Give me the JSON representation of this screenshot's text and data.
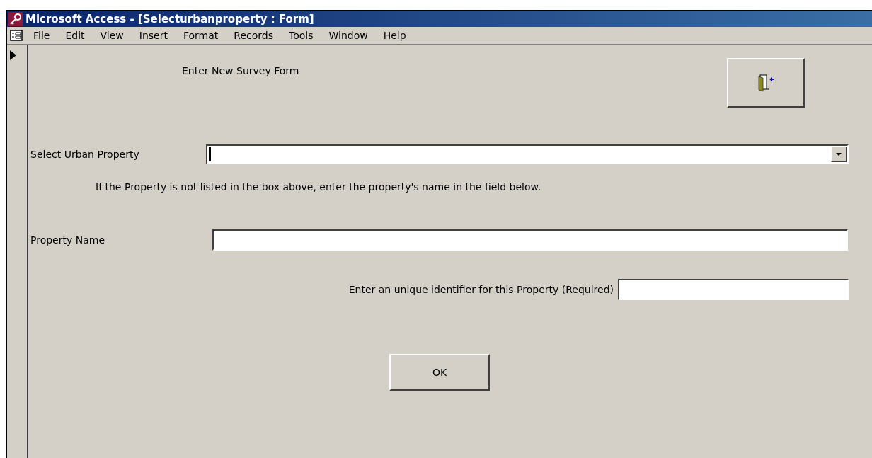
{
  "window": {
    "title": "Microsoft Access - [Selecturbanproperty : Form]"
  },
  "menu": [
    {
      "label": "File"
    },
    {
      "label": "Edit"
    },
    {
      "label": "View"
    },
    {
      "label": "Insert"
    },
    {
      "label": "Format"
    },
    {
      "label": "Records"
    },
    {
      "label": "Tools"
    },
    {
      "label": "Window"
    },
    {
      "label": "Help"
    }
  ],
  "form": {
    "heading": "Enter New Survey Form",
    "select_label": "Select Urban Property",
    "hint": "If the Property is not listed in the box above, enter the property's name in the field below.",
    "name_label": "Property Name",
    "identifier_label": "Enter an unique identifier for this Property (Required)",
    "ok_button": "OK"
  }
}
